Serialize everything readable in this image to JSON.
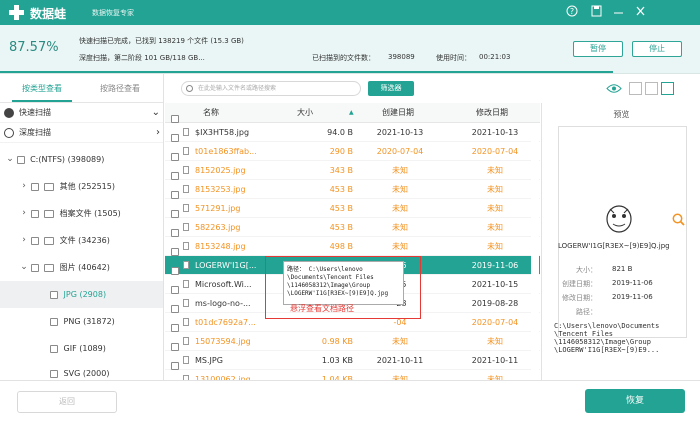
{
  "app": {
    "title": "数据蛙",
    "subtitle": "数据恢复专家"
  },
  "status": {
    "percent": "87.57%",
    "line1": "快速扫描已完成，已找到 138219 个文件 (15.3 GB)",
    "line2": "深度扫描，第二阶段 101 GB/118 GB...",
    "found_label": "已扫描到的文件数：",
    "found_count": "398089",
    "time_label": "使用时间：",
    "time_value": "00:21:03",
    "progress": 0.8757
  },
  "buttons": {
    "pause": "暂停",
    "stop": "停止",
    "filter": "筛选器",
    "back": "返回",
    "recover": "恢复"
  },
  "view_tabs": {
    "by_type": "按类型查看",
    "by_path": "按路径查看"
  },
  "scan_modes": {
    "quick": "快速扫描",
    "deep": "深度扫描"
  },
  "tree": [
    {
      "label": "C:(NTFS) (398089)"
    },
    {
      "label": "其他 (252515)"
    },
    {
      "label": "档案文件 (1505)"
    },
    {
      "label": "文件 (34236)"
    },
    {
      "label": "图片 (40642)"
    },
    {
      "label": "JPG (2908)"
    },
    {
      "label": "PNG (31872)"
    },
    {
      "label": "GIF (1089)"
    },
    {
      "label": "SVG (2000)"
    }
  ],
  "search": {
    "placeholder": "在此处输入文件名或路径搜索"
  },
  "columns": {
    "name": "名称",
    "size": "大小",
    "created": "创建日期",
    "modified": "修改日期"
  },
  "rows": [
    {
      "name": "$IX3HT58.jpg",
      "size": "94.0  B",
      "created": "2021-10-13",
      "modified": "2021-10-13"
    },
    {
      "name": "t01e1863ffab...",
      "size": "290  B",
      "created": "2020-07-04",
      "modified": "2020-07-04"
    },
    {
      "name": "8152025.jpg",
      "size": "343  B",
      "created": "未知",
      "modified": "未知"
    },
    {
      "name": "8153253.jpg",
      "size": "453  B",
      "created": "未知",
      "modified": "未知"
    },
    {
      "name": "571291.jpg",
      "size": "453  B",
      "created": "未知",
      "modified": "未知"
    },
    {
      "name": "582263.jpg",
      "size": "453  B",
      "created": "未知",
      "modified": "未知"
    },
    {
      "name": "8153248.jpg",
      "size": "498  B",
      "created": "未知",
      "modified": "未知"
    },
    {
      "name": "LOGERW'I1G[...",
      "size": "",
      "created": "-06",
      "modified": "2019-11-06"
    },
    {
      "name": "Microsoft.Wi...",
      "size": "",
      "created": "-15",
      "modified": "2021-10-15"
    },
    {
      "name": "ms-logo-no-...",
      "size": "",
      "created": "-28",
      "modified": "2019-08-28"
    },
    {
      "name": "t01dc7692a7...",
      "size": "",
      "created": "-04",
      "modified": "2020-07-04"
    },
    {
      "name": "15073594.jpg",
      "size": "0.98 KB",
      "created": "未知",
      "modified": "未知"
    },
    {
      "name": "MS.JPG",
      "size": "1.03 KB",
      "created": "2021-10-11",
      "modified": "2021-10-11"
    },
    {
      "name": "13100062.jpg",
      "size": "1.04 KB",
      "created": "未知",
      "modified": "未知"
    }
  ],
  "tooltip": {
    "text": "路径： C:\\Users\\lenovo\n\\Documents\\Tencent Files\n\\1146058312\\Image\\Group\n\\LOGERW'I1G[R3EX~[9)E9]Q.jpg"
  },
  "annotation": {
    "text": "悬浮查看文档路径"
  },
  "preview": {
    "title": "预览",
    "filename": "LOGERW'I1G[R3EX~[9)E9]Q.jpg",
    "size_label": "大小：",
    "size": "821  B",
    "created_label": "创建日期：",
    "created": "2019-11-06",
    "modified_label": "修改日期：",
    "modified": "2019-11-06",
    "path_label": "路径：",
    "path": "C:\\Users\\lenovo\\Documents\n\\Tencent Files\n\\1146058312\\Image\\Group\n\\LOGERW'I1G[R3EX~[9)E9..."
  },
  "colors": {
    "accent": "#23a393",
    "orange": "#f39322",
    "annotation_red": "#e53935"
  }
}
